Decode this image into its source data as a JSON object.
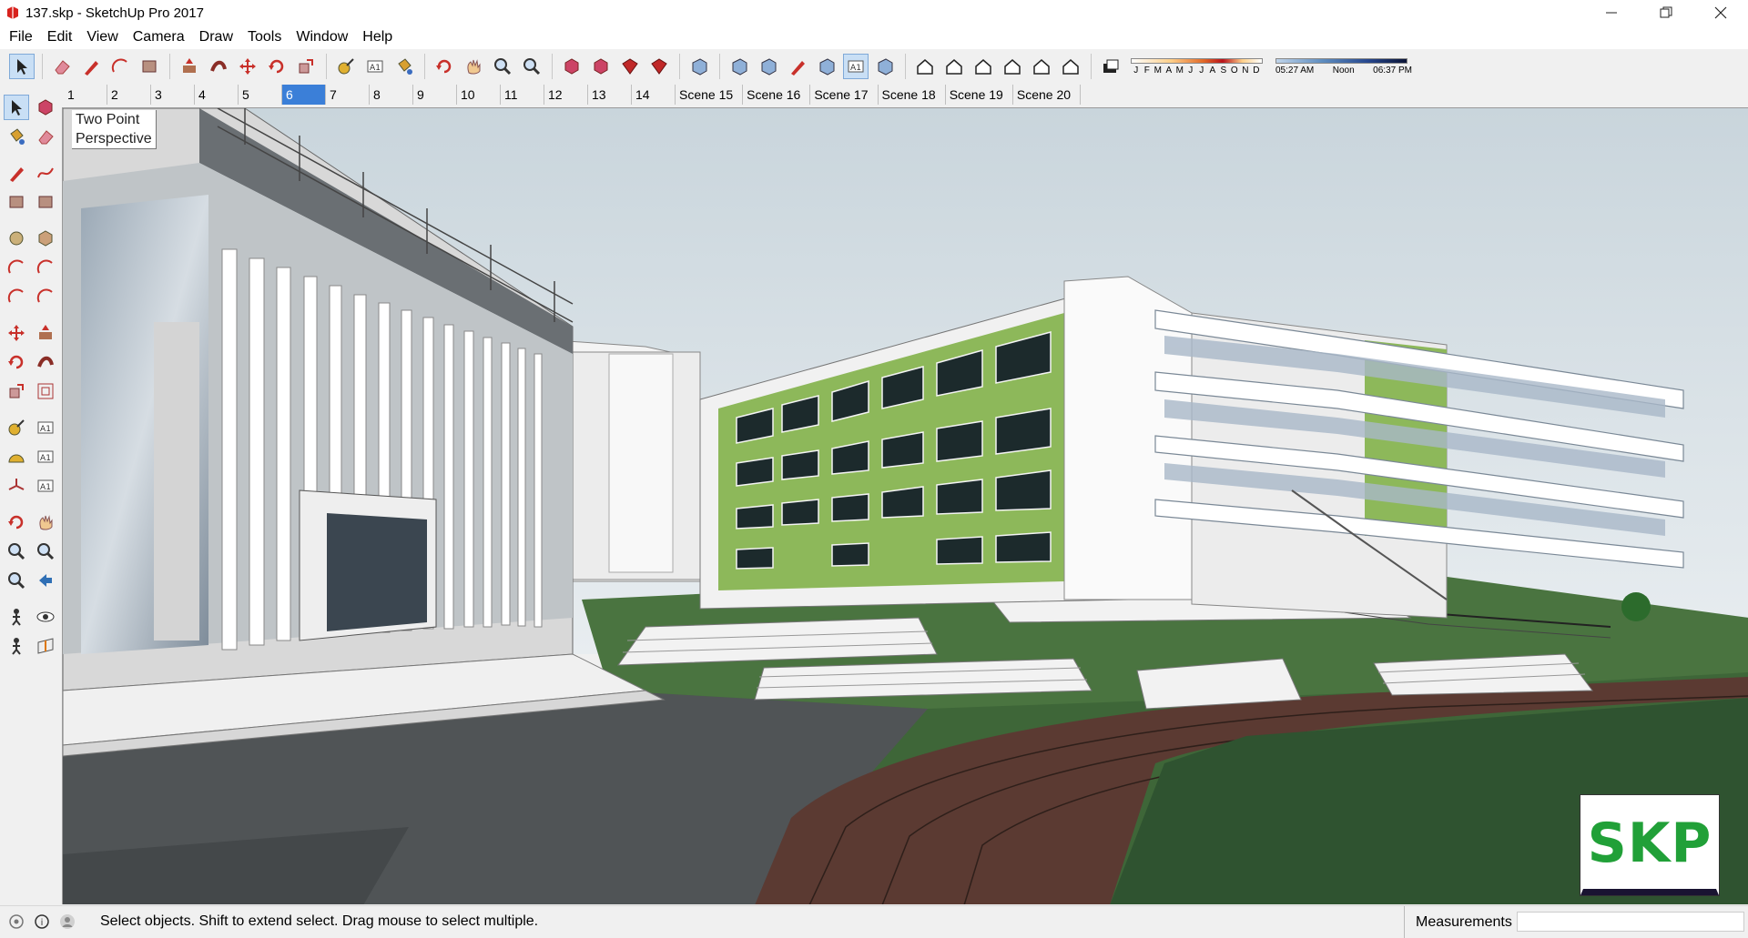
{
  "window": {
    "title": "137.skp - SketchUp Pro 2017",
    "controls": [
      "minimize",
      "restore",
      "close"
    ]
  },
  "menu": [
    "File",
    "Edit",
    "View",
    "Camera",
    "Draw",
    "Tools",
    "Window",
    "Help"
  ],
  "toolbar": {
    "tools": [
      {
        "icon": "select-arrow-icon",
        "active": true
      },
      {
        "icon": "eraser-icon"
      },
      {
        "icon": "pencil-line-icon"
      },
      {
        "icon": "arc-icon"
      },
      {
        "icon": "shapes-icon"
      },
      {
        "icon": "push-pull-icon"
      },
      {
        "icon": "follow-me-icon"
      },
      {
        "icon": "move-icon"
      },
      {
        "icon": "rotate-icon"
      },
      {
        "icon": "scale-icon"
      },
      {
        "icon": "tape-measure-icon"
      },
      {
        "icon": "text-icon"
      },
      {
        "icon": "paint-bucket-icon"
      },
      {
        "icon": "orbit-icon"
      },
      {
        "icon": "pan-icon"
      },
      {
        "icon": "zoom-icon"
      },
      {
        "icon": "zoom-extents-icon"
      },
      {
        "icon": "warehouse-icon"
      },
      {
        "icon": "extension-warehouse-icon"
      },
      {
        "icon": "send-to-layout-icon"
      },
      {
        "icon": "ruby-console-icon"
      },
      {
        "icon": "xray-icon"
      },
      {
        "icon": "back-edges-icon"
      },
      {
        "icon": "wireframe-icon"
      },
      {
        "icon": "hidden-line-icon"
      },
      {
        "icon": "shaded-icon"
      },
      {
        "icon": "shaded-textures-icon",
        "active": true
      },
      {
        "icon": "monochrome-icon"
      },
      {
        "icon": "iso-view-icon"
      },
      {
        "icon": "top-view-icon"
      },
      {
        "icon": "front-view-icon"
      },
      {
        "icon": "right-view-icon"
      },
      {
        "icon": "back-view-icon"
      },
      {
        "icon": "left-view-icon"
      },
      {
        "icon": "shadows-toggle-icon"
      }
    ],
    "shadow_months": [
      "J",
      "F",
      "M",
      "A",
      "M",
      "J",
      "J",
      "A",
      "S",
      "O",
      "N",
      "D"
    ],
    "shadow_time": {
      "start": "05:27 AM",
      "mid": "Noon",
      "end": "06:37 PM"
    }
  },
  "scenes": {
    "tabs": [
      "1",
      "2",
      "3",
      "4",
      "5",
      "6",
      "7",
      "8",
      "9",
      "10",
      "11",
      "12",
      "13",
      "14",
      "Scene 15",
      "Scene 16",
      "Scene 17",
      "Scene 18",
      "Scene 19",
      "Scene 20"
    ],
    "active_index": 5
  },
  "left_tools": [
    "select-icon",
    "component-icon",
    "paint-bucket-icon",
    "eraser-icon",
    "pencil-icon",
    "freehand-icon",
    "rectangle-icon",
    "rotated-rectangle-icon",
    "circle-icon",
    "polygon-icon",
    "arc-icon",
    "two-point-arc-icon",
    "three-point-arc-icon",
    "pie-icon",
    "move-icon",
    "push-pull-icon",
    "rotate-icon",
    "follow-me-icon",
    "scale-icon",
    "offset-icon",
    "tape-measure-icon",
    "dimension-icon",
    "protractor-icon",
    "text-icon",
    "axes-icon",
    "3d-text-icon",
    "orbit-icon",
    "pan-icon",
    "zoom-icon",
    "zoom-window-icon",
    "zoom-extents-icon",
    "previous-view-icon",
    "position-camera-icon",
    "look-around-icon",
    "walk-icon",
    "section-plane-icon"
  ],
  "viewport": {
    "scene_label": "Two Point\nPerspective",
    "logo_text": "SKP",
    "colors": {
      "sky_top": "#ced9df",
      "sky_bottom": "#e6ecef",
      "grass": "#3f6b3a",
      "track": "#5b3a32",
      "facade_green": "#8db85a"
    }
  },
  "statusbar": {
    "message": "Select objects. Shift to extend select. Drag mouse to select multiple.",
    "measurements_label": "Measurements",
    "measurements_value": ""
  }
}
